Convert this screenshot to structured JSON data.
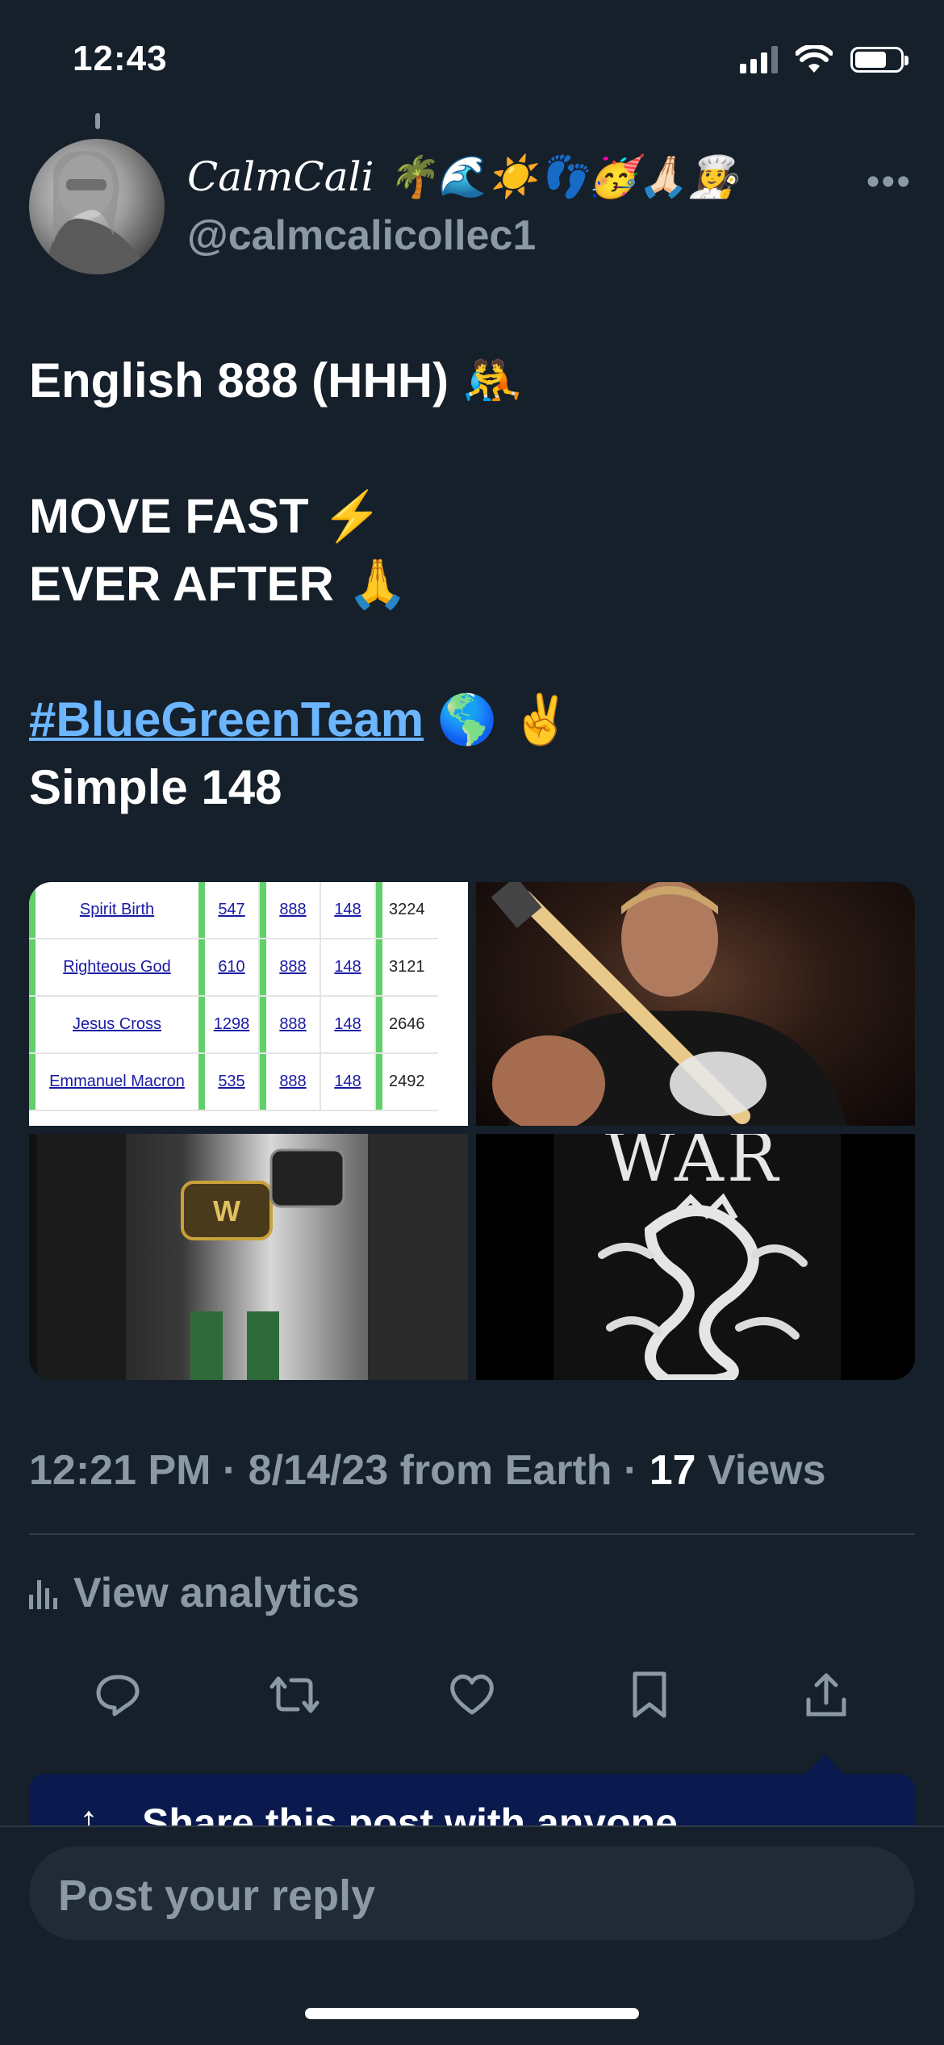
{
  "status_bar": {
    "time": "12:43"
  },
  "tweet": {
    "display_name": "CalmCali 🌴🌊☀️👣🥳🙏🏻👩‍🍳",
    "handle": "@calmcalicollec1",
    "more_label": "•••",
    "lines": [
      "English 888 (HHH) 🤼",
      "MOVE FAST ⚡",
      "EVER AFTER 🙏",
      "🌎 ✌️",
      "Simple 148"
    ],
    "hashtag": "#BlueGreenTeam",
    "media": {
      "table_rows": [
        {
          "name": "Spirit Birth",
          "a": "547",
          "b": "888",
          "c": "148",
          "d": "3224"
        },
        {
          "name": "Righteous God",
          "a": "610",
          "b": "888",
          "c": "148",
          "d": "3121"
        },
        {
          "name": "Jesus Cross",
          "a": "1298",
          "b": "888",
          "c": "148",
          "d": "2646"
        },
        {
          "name": "Emmanuel Macron",
          "a": "535",
          "b": "888",
          "c": "148",
          "d": "2492"
        }
      ],
      "war_text": "WAR"
    },
    "meta": {
      "time": "12:21 PM",
      "sep": " · ",
      "date_source": "8/14/23 from Earth",
      "views_count": "17",
      "views_label": " Views"
    },
    "analytics_label": "View analytics"
  },
  "share_tooltip": {
    "text": "Share this post with anyone"
  },
  "reply": {
    "placeholder": "Post your reply"
  }
}
